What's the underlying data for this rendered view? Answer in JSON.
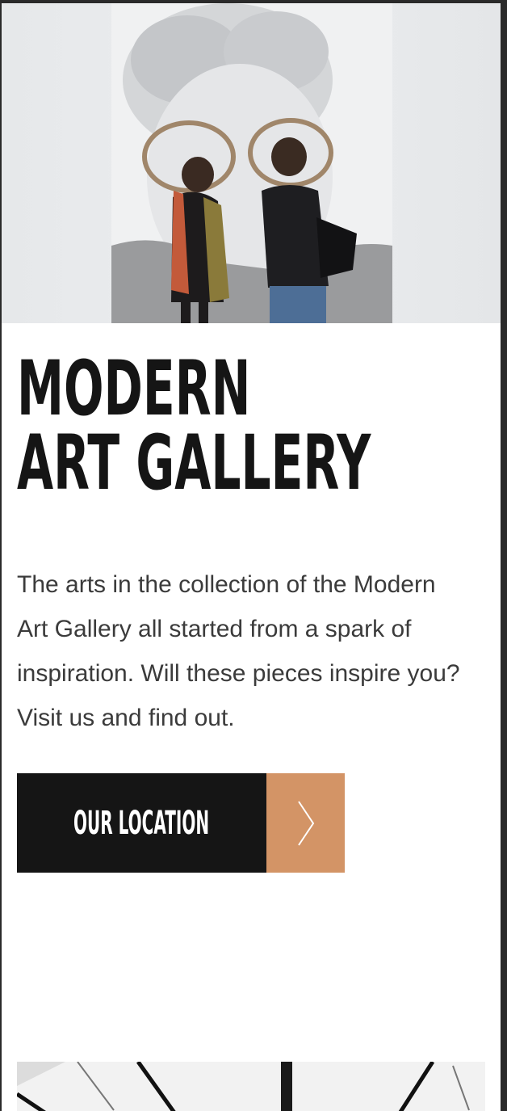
{
  "hero": {
    "image": "visitors-viewing-portrait-painting"
  },
  "title": {
    "line1": "MODERN",
    "line2": "ART GALLERY"
  },
  "description": "The arts in the collection of the Modern Art Gallery all started from a spark of inspiration. Will these pieces inspire you? Visit us and find out.",
  "cta": {
    "label": "OUR LOCATION",
    "icon": "chevron-right-icon"
  },
  "gallery_preview": {
    "image": "gallery-interior-photo"
  },
  "colors": {
    "text_dark": "#151515",
    "body_text": "#3b3b3b",
    "accent": "#d39466",
    "background": "#ffffff"
  }
}
